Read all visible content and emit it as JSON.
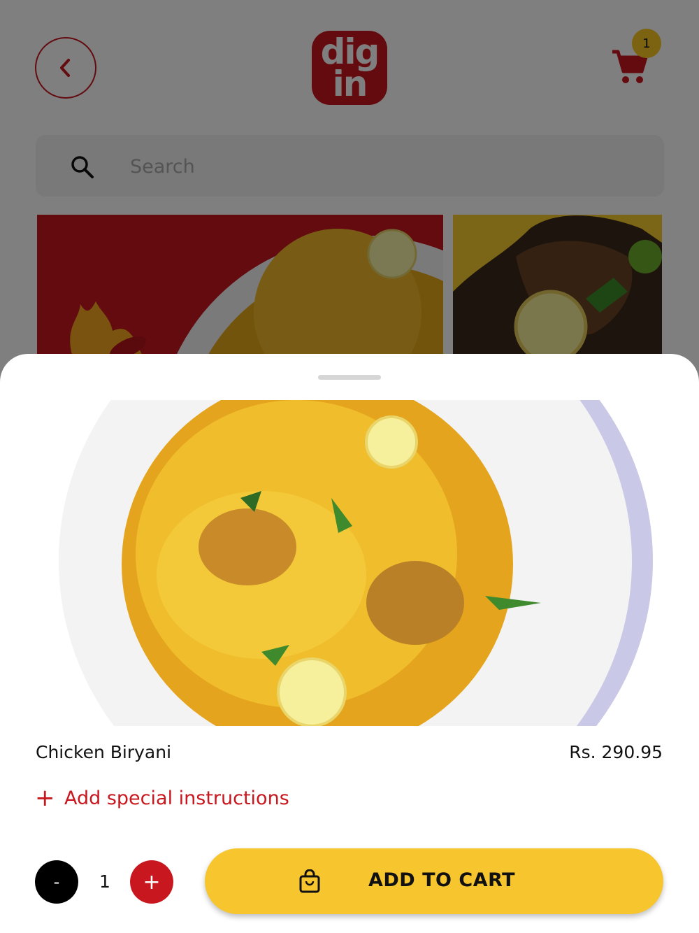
{
  "header": {
    "logo_line1": "dig",
    "logo_line2": "in",
    "cart_count": "1"
  },
  "search": {
    "placeholder": "Search"
  },
  "item": {
    "name": "Chicken Biryani",
    "price": "Rs. 290.95",
    "special_instructions_label": "Add special instructions",
    "quantity": "1"
  },
  "actions": {
    "minus_label": "-",
    "plus_label": "+",
    "add_to_cart_label": "ADD TO CART"
  },
  "colors": {
    "brand_red": "#c8171e",
    "accent_yellow": "#f7c62e",
    "backdrop": "rgba(0,0,0,0.5)"
  },
  "icons": [
    "back-chevron-icon",
    "cart-icon",
    "search-icon",
    "plus-icon",
    "shopping-bag-icon"
  ]
}
